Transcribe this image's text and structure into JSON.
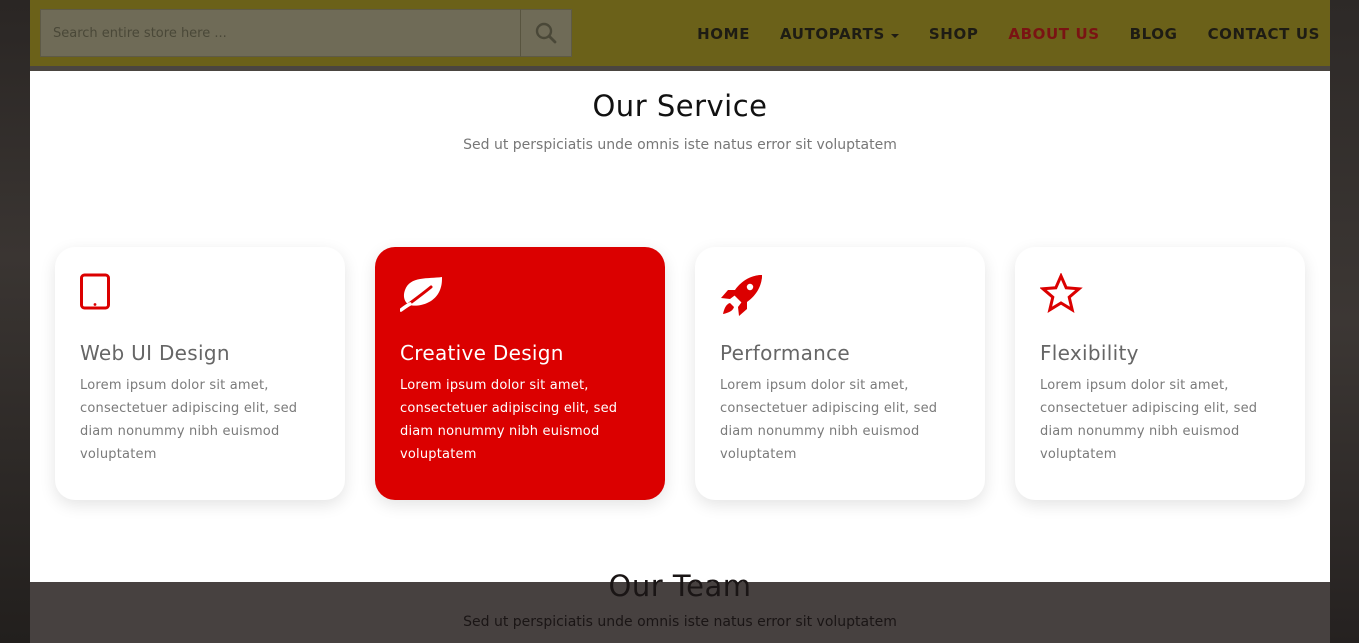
{
  "header": {
    "search": {
      "placeholder": "Search entire store here ...",
      "icon": "search-icon"
    },
    "nav": [
      {
        "label": "HOME"
      },
      {
        "label": "AUTOPARTS",
        "dropdown": true
      },
      {
        "label": "SHOP"
      },
      {
        "label": "ABOUT US",
        "active": true
      },
      {
        "label": "BLOG"
      },
      {
        "label": "CONTACT US"
      }
    ]
  },
  "service": {
    "title": "Our Service",
    "subtitle": "Sed ut perspiciatis unde omnis iste natus error sit voluptatem",
    "cards": [
      {
        "icon": "tablet-icon",
        "title": "Web UI Design",
        "text": "Lorem ipsum dolor sit amet, consectetuer adipiscing elit, sed diam nonummy nibh euismod voluptatem",
        "highlighted": false
      },
      {
        "icon": "leaf-icon",
        "title": "Creative Design",
        "text": "Lorem ipsum dolor sit amet, consectetuer adipiscing elit, sed diam nonummy nibh euismod voluptatem",
        "highlighted": true
      },
      {
        "icon": "rocket-icon",
        "title": "Performance",
        "text": "Lorem ipsum dolor sit amet, consectetuer adipiscing elit, sed diam nonummy nibh euismod voluptatem",
        "highlighted": false
      },
      {
        "icon": "star-icon",
        "title": "Flexibility",
        "text": "Lorem ipsum dolor sit amet, consectetuer adipiscing elit, sed diam nonummy nibh euismod voluptatem",
        "highlighted": false
      }
    ]
  },
  "team": {
    "title": "Our Team",
    "subtitle": "Sed ut perspiciatis unde omnis iste natus error sit voluptatem"
  },
  "colors": {
    "accent": "#db0000",
    "header_bg": "#6b6119",
    "active_nav": "#7a1313"
  }
}
